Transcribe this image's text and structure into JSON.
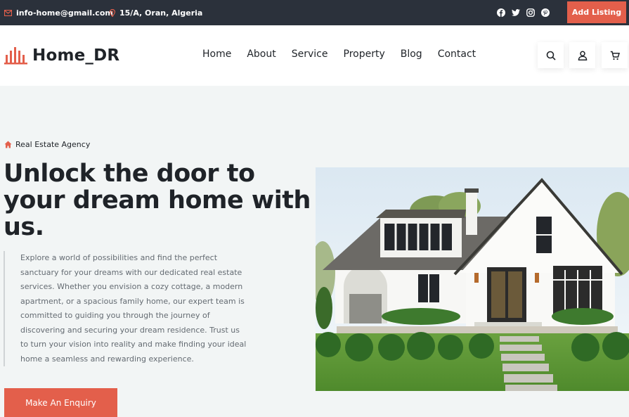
{
  "topbar": {
    "email": "info-home@gmail.com",
    "address": "15/A, Oran, Algeria",
    "socials": [
      "facebook-icon",
      "twitter-icon",
      "instagram-icon",
      "pinterest-icon"
    ],
    "add_listing": "Add Listing"
  },
  "header": {
    "logo_text": "Home_DR",
    "nav": [
      "Home",
      "About",
      "Service",
      "Property",
      "Blog",
      "Contact"
    ],
    "actions": [
      "search-icon",
      "user-icon",
      "cart-icon"
    ]
  },
  "hero": {
    "eyebrow": "Real Estate Agency",
    "headline": "Unlock the door to your dream home with us.",
    "description": "Explore a world of possibilities and find the perfect sanctuary for your dreams with our dedicated real estate services. Whether you envision a cozy cottage, a modern apartment, or a spacious family home, our expert team is committed to guiding you through the journey of discovering and securing your dream residence. Trust us to turn your vision into reality and make finding your ideal home a seamless and rewarding experience.",
    "cta": "Make An Enquiry"
  },
  "colors": {
    "accent": "#e35f4b",
    "topbar_bg": "#2b313b",
    "page_bg": "#f2f5f5",
    "text_dark": "#1f2328"
  }
}
